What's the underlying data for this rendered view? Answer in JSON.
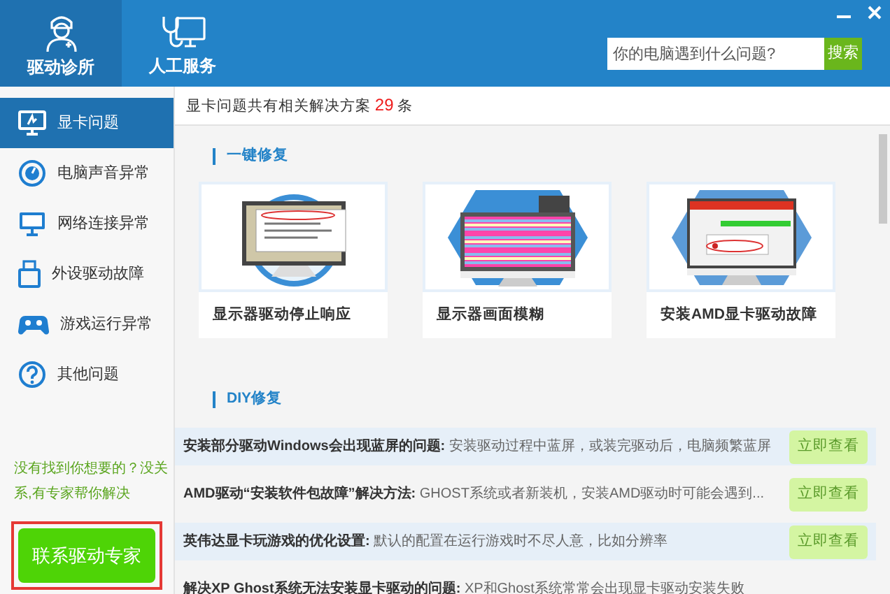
{
  "header": {
    "tabs": [
      {
        "label": "驱动诊所",
        "kind": "doctor",
        "selected": true
      },
      {
        "label": "人工服务",
        "kind": "service",
        "selected": false
      }
    ],
    "search": {
      "placeholder": "你的电脑遇到什么问题?",
      "button": "搜索"
    }
  },
  "sidebar": {
    "items": [
      {
        "label": "显卡问题",
        "kind": "display",
        "selected": true
      },
      {
        "label": "电脑声音异常",
        "kind": "sound",
        "selected": false
      },
      {
        "label": "网络连接异常",
        "kind": "network",
        "selected": false
      },
      {
        "label": "外设驱动故障",
        "kind": "usb",
        "selected": false
      },
      {
        "label": "游戏运行异常",
        "kind": "game",
        "selected": false
      },
      {
        "label": "其他问题",
        "kind": "help",
        "selected": false
      }
    ],
    "hint": "没有找到你想要的？没关系,有专家帮你解决",
    "contact_button": "联系驱动专家"
  },
  "summary": {
    "prefix": "显卡问题共有相关解决方案",
    "count": "29",
    "suffix": "条"
  },
  "quick_fix": {
    "title": "一键修复",
    "cards": [
      {
        "title": "显示器驱动停止响应",
        "kind": "dialog"
      },
      {
        "title": "显示器画面模糊",
        "kind": "stripes"
      },
      {
        "title": "安装AMD显卡驱动故障",
        "kind": "installer"
      }
    ]
  },
  "diy_fix": {
    "title": "DIY修复",
    "rows": [
      {
        "title": "安装部分驱动Windows会出现蓝屏的问题:",
        "text": "安装驱动过程中蓝屏，或装完驱动后，电脑频繁蓝屏",
        "button": "立即查看"
      },
      {
        "title": "AMD驱动“安装软件包故障”解决方法:",
        "text": "GHOST系统或者新装机，安装AMD驱动时可能会遇到...",
        "button": "立即查看"
      },
      {
        "title": "英伟达显卡玩游戏的优化设置:",
        "text": "默认的配置在运行游戏时不尽人意，比如分辨率",
        "button": "立即查看"
      },
      {
        "title": "解决XP Ghost系统无法安装显卡驱动的问题:",
        "text": "XP和Ghost系统常常会出现显卡驱动安装失败",
        "button": ""
      }
    ]
  }
}
